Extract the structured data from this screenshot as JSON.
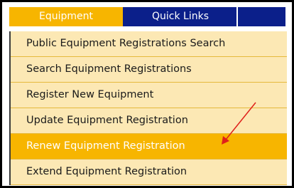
{
  "tabs": [
    {
      "label": "Equipment"
    },
    {
      "label": "Quick Links"
    }
  ],
  "menu": {
    "items": [
      {
        "label": "Public Equipment Registrations Search"
      },
      {
        "label": "Search Equipment Registrations"
      },
      {
        "label": "Register New Equipment"
      },
      {
        "label": "Update Equipment Registration"
      },
      {
        "label": "Renew Equipment Registration"
      },
      {
        "label": "Extend Equipment Registration"
      }
    ],
    "highlighted_index": 4
  },
  "colors": {
    "tab_active": "#f7b500",
    "tab_inactive": "#0b1f8a",
    "menu_bg": "#fce8b4",
    "menu_highlight": "#f7b500",
    "annotation_arrow": "#e0201a"
  }
}
